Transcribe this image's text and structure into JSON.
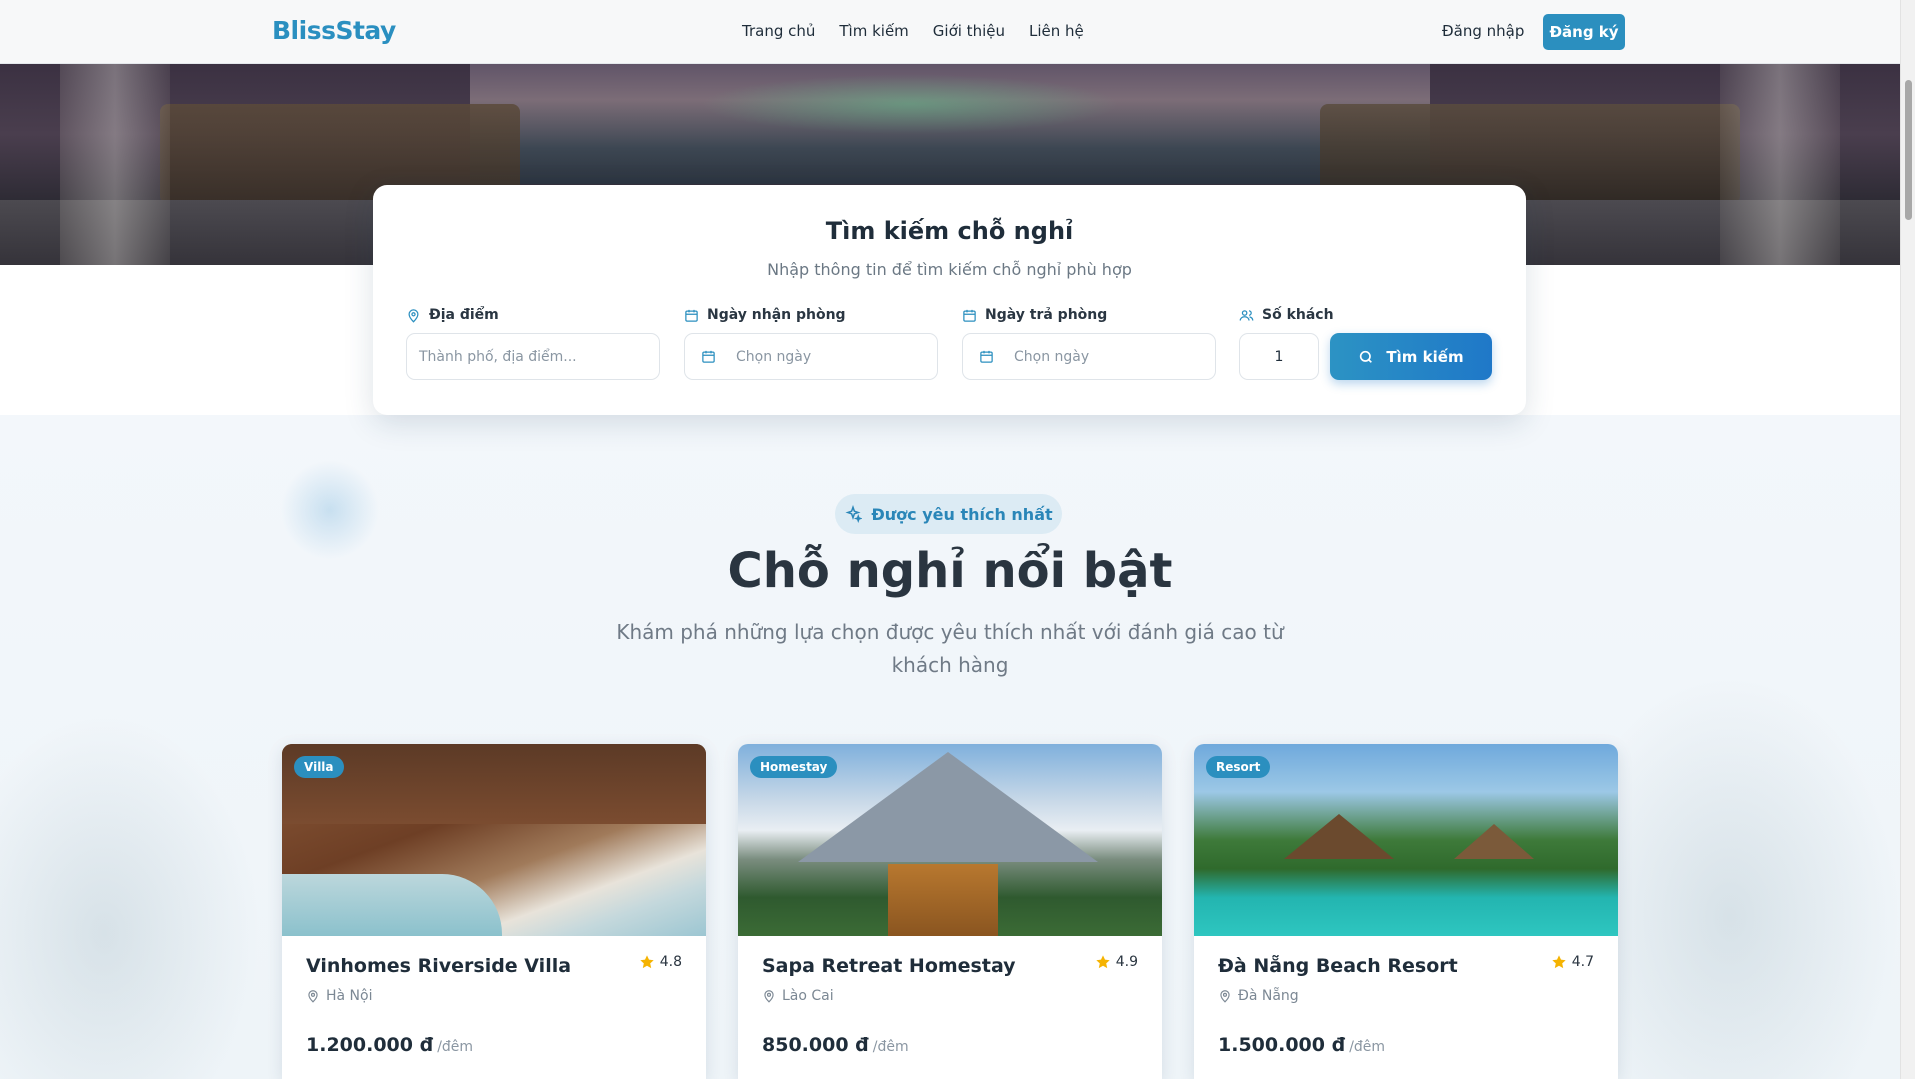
{
  "header": {
    "logo": "BlissStay",
    "nav": [
      "Trang chủ",
      "Tìm kiếm",
      "Giới thiệu",
      "Liên hệ"
    ],
    "login": "Đăng nhập",
    "register": "Đăng ký"
  },
  "search": {
    "title": "Tìm kiếm chỗ nghỉ",
    "subtitle": "Nhập thông tin để tìm kiếm chỗ nghỉ phù hợp",
    "location_label": "Địa điểm",
    "location_placeholder": "Thành phố, địa điểm...",
    "checkin_label": "Ngày nhận phòng",
    "checkin_placeholder": "Chọn ngày",
    "checkout_label": "Ngày trả phòng",
    "checkout_placeholder": "Chọn ngày",
    "guests_label": "Số khách",
    "guests_value": "1",
    "button": "Tìm kiếm"
  },
  "featured": {
    "pill": "Được yêu thích nhất",
    "title": "Chỗ nghỉ nổi bật",
    "subtitle": "Khám phá những lựa chọn được yêu thích nhất với đánh giá cao từ khách hàng",
    "cards": [
      {
        "badge": "Villa",
        "name": "Vinhomes Riverside Villa",
        "rating": "4.8",
        "location": "Hà Nội",
        "price": "1.200.000 đ",
        "unit": "/đêm"
      },
      {
        "badge": "Homestay",
        "name": "Sapa Retreat Homestay",
        "rating": "4.9",
        "location": "Lào Cai",
        "price": "850.000 đ",
        "unit": "/đêm"
      },
      {
        "badge": "Resort",
        "name": "Đà Nẵng Beach Resort",
        "rating": "4.7",
        "location": "Đà Nẵng",
        "price": "1.500.000 đ",
        "unit": "/đêm"
      }
    ]
  },
  "colors": {
    "accent": "#2b8fbf",
    "star": "#f5b301"
  }
}
